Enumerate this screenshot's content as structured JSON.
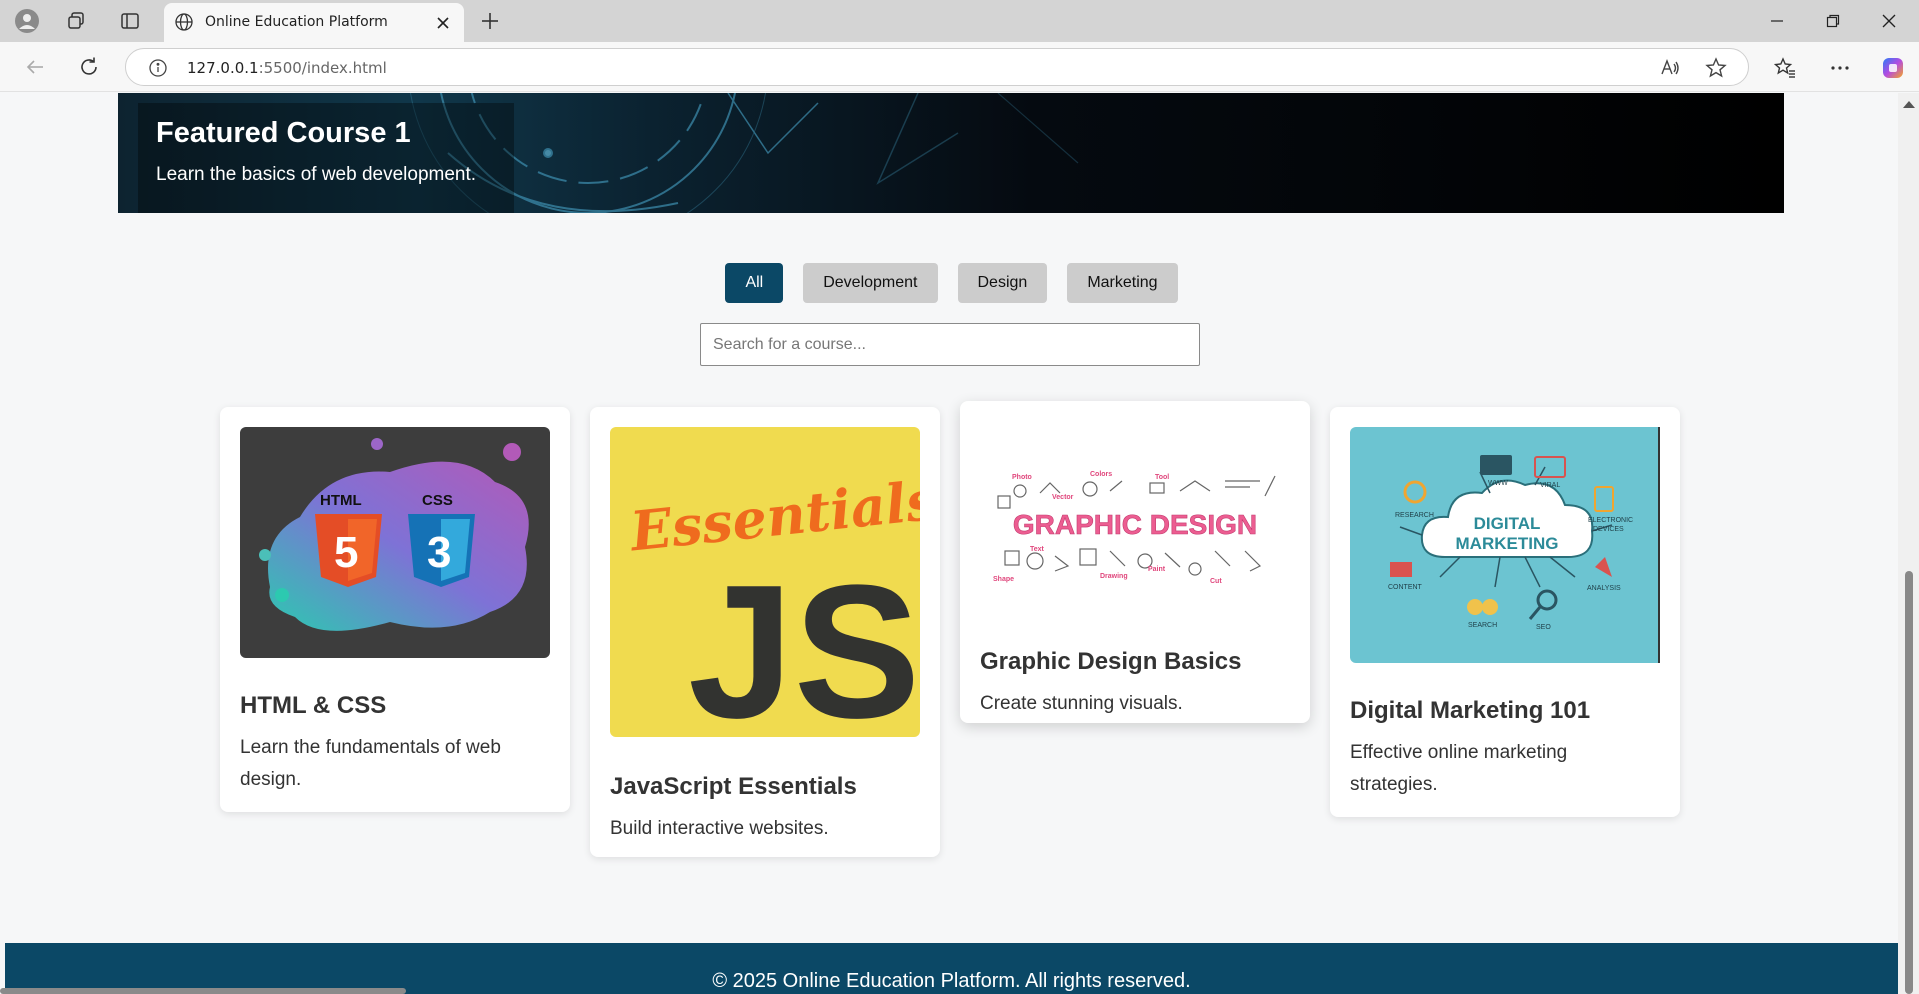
{
  "browser": {
    "tab_title": "Online Education Platform",
    "url_host": "127.0.0.1",
    "url_path": ":5500/index.html"
  },
  "hero": {
    "title": "Featured Course 1",
    "subtitle": "Learn the basics of web development."
  },
  "filters": [
    {
      "label": "All",
      "active": true
    },
    {
      "label": "Development",
      "active": false
    },
    {
      "label": "Design",
      "active": false
    },
    {
      "label": "Marketing",
      "active": false
    }
  ],
  "search": {
    "placeholder": "Search for a course..."
  },
  "courses": [
    {
      "title": "HTML & CSS",
      "description": "Learn the fundamentals of web design.",
      "image_text": [
        "HTML",
        "CSS"
      ]
    },
    {
      "title": "JavaScript Essentials",
      "description": "Build interactive websites.",
      "image_text": [
        "Essentials",
        "JS"
      ]
    },
    {
      "title": "Graphic Design Basics",
      "description": "Create stunning visuals.",
      "image_text": [
        "GRAPHIC DESIGN",
        "Photo",
        "Vector",
        "Colors",
        "Tool",
        "Text",
        "Shape",
        "Drawing",
        "Paint",
        "Cut"
      ]
    },
    {
      "title": "Digital Marketing 101",
      "description": "Effective online marketing strategies.",
      "image_text": [
        "DIGITAL",
        "MARKETING",
        "RESEARCH",
        "WWW",
        "VIRAL",
        "ELECTRONIC",
        "DEVICES",
        "CONTENT",
        "ANALYSIS",
        "SEARCH",
        "SEO"
      ]
    }
  ],
  "footer": {
    "text": "© 2025 Online Education Platform. All rights reserved."
  },
  "colors": {
    "primary": "#0b4866",
    "filter_inactive": "#cccccc",
    "js_yellow": "#f0db4f",
    "marketing_teal": "#6cc4d1"
  }
}
